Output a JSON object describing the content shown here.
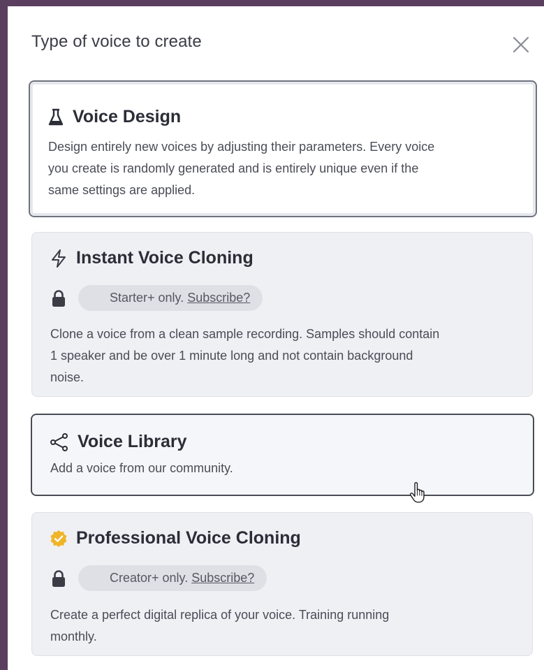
{
  "dialog": {
    "title": "Type of voice to create",
    "close_icon": "close-icon"
  },
  "options": [
    {
      "id": "voice-design",
      "icon": "flask-icon",
      "title": "Voice Design",
      "state": "selected",
      "description_lines": [
        "Design entirely new voices by adjusting their parameters. Every voice",
        "you create is randomly generated and is entirely unique even if the",
        "same settings are applied."
      ]
    },
    {
      "id": "instant-voice-cloning",
      "icon": "lightning-icon",
      "title": "Instant Voice Cloning",
      "state": "locked",
      "lock_icon": "lock-icon",
      "requirement": "Starter+ only.",
      "subscribe_link": "Subscribe?",
      "description_lines": [
        "Clone a voice from a clean sample recording. Samples should contain",
        "1 speaker and be over 1 minute long and not contain background",
        "noise."
      ]
    },
    {
      "id": "voice-library",
      "icon": "share-icon",
      "title": "Voice Library",
      "state": "hover",
      "description_lines": [
        "Add a voice from our community."
      ]
    },
    {
      "id": "professional-voice-cloning",
      "icon": "verified-badge-icon",
      "title": "Professional Voice Cloning",
      "state": "locked",
      "lock_icon": "lock-icon",
      "requirement": "Creator+ only.",
      "subscribe_link": "Subscribe?",
      "description_lines": [
        "Create a perfect digital replica of your voice. Training running",
        "monthly."
      ]
    }
  ],
  "colors": {
    "frame": "#5b3f5f",
    "text_primary": "#2b2d37",
    "text_secondary": "#4a4c56",
    "card_disabled_bg": "#eff0f4",
    "pill_bg": "#dfe0e6",
    "badge": "#f0b429"
  },
  "cursor": "hand-pointer-icon"
}
